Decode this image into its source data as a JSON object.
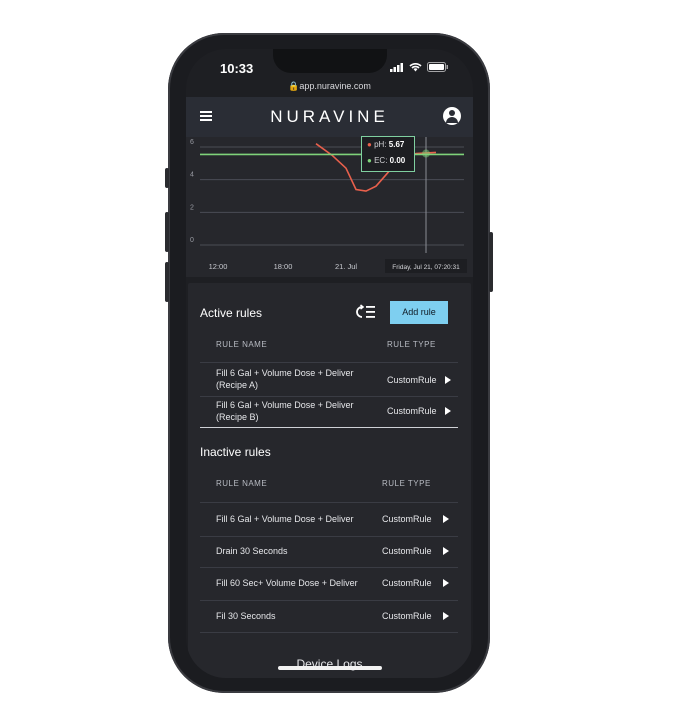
{
  "status": {
    "time": "10:33",
    "url": "app.nuravine.com"
  },
  "app": {
    "brand": "NURAVINE",
    "menu_icon": "hamburger-menu-icon",
    "profile_icon": "user-avatar-icon"
  },
  "chart": {
    "tooltip": {
      "ph_label": "pH:",
      "ph_value": "5.67",
      "ec_label": "EC:",
      "ec_value": "0.00"
    },
    "crosshair_label": "Friday, Jul 21, 07:20:31",
    "colors": {
      "ph": "#e8604c",
      "ec": "#7fd37a",
      "grid": "#4a4c55"
    }
  },
  "chart_data": {
    "type": "line",
    "x_ticks": [
      "12:00",
      "18:00",
      "21. Jul"
    ],
    "y_ticks": [
      "6",
      "4",
      "2",
      "0"
    ],
    "ylim": [
      0,
      6
    ],
    "series": [
      {
        "name": "pH",
        "color": "#e8604c",
        "points": [
          [
            0.0,
            6.2
          ],
          [
            0.08,
            5.5
          ],
          [
            0.15,
            4.7
          ],
          [
            0.2,
            3.4
          ],
          [
            0.25,
            3.3
          ],
          [
            0.3,
            3.6
          ],
          [
            0.35,
            4.3
          ],
          [
            0.42,
            5.3
          ],
          [
            0.5,
            5.6
          ],
          [
            0.6,
            5.67
          ]
        ]
      },
      {
        "name": "EC",
        "color": "#7fd37a",
        "points": [
          [
            -2.0,
            5.55
          ],
          [
            0.6,
            5.55
          ],
          [
            1.0,
            5.55
          ]
        ]
      }
    ]
  },
  "active": {
    "title": "Active rules",
    "add_button": "Add rule",
    "col_name": "RULE NAME",
    "col_type": "RULE TYPE",
    "rows": [
      {
        "name_l1": "Fill 6 Gal + Volume Dose + Deliver",
        "name_l2": "(Recipe A)",
        "type": "CustomRule"
      },
      {
        "name_l1": "Fill 6 Gal + Volume Dose + Deliver",
        "name_l2": "(Recipe B)",
        "type": "CustomRule"
      }
    ]
  },
  "inactive": {
    "title": "Inactive rules",
    "col_name": "RULE NAME",
    "col_type": "RULE TYPE",
    "rows": [
      {
        "name": "Fill 6 Gal + Volume Dose + Deliver",
        "type": "CustomRule"
      },
      {
        "name": "Drain 30 Seconds",
        "type": "CustomRule"
      },
      {
        "name": "Fill 60 Sec+ Volume Dose + Deliver",
        "type": "CustomRule"
      },
      {
        "name": "Fil 30 Seconds",
        "type": "CustomRule"
      }
    ]
  },
  "footer": {
    "label": "Device Logs"
  }
}
